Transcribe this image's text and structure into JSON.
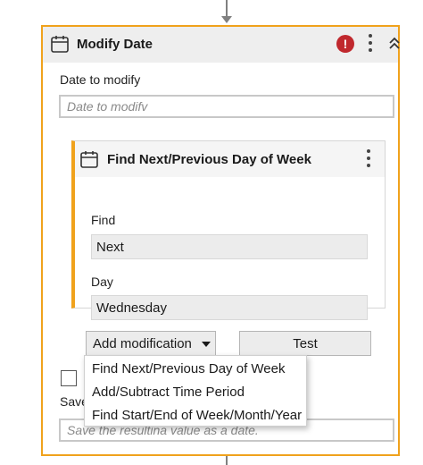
{
  "activity": {
    "title": "Modify Date",
    "icons": {
      "calendar": "calendar-icon",
      "error": "error-icon",
      "more": "more-options-icon",
      "collapse": "collapse-icon"
    },
    "error_symbol": "!",
    "date_label": "Date to modify",
    "date_placeholder": "Date to modifv",
    "sub_activity": {
      "title": "Find Next/Previous Day of Week",
      "find_label": "Find",
      "find_value": "Next",
      "day_label": "Day",
      "day_value": "Wednesday"
    },
    "add_modification_label": "Add modification",
    "test_label": "Test",
    "save_label_partial": "Save",
    "save_placeholder": "Save the resultina value as a date.",
    "menu": {
      "items": [
        "Find Next/Previous Day of Week",
        "Add/Subtract Time Period",
        "Find Start/End of Week/Month/Year"
      ]
    }
  },
  "colors": {
    "accent": "#f0a21c",
    "error": "#c0282d",
    "header_bg": "#eeeeee"
  }
}
